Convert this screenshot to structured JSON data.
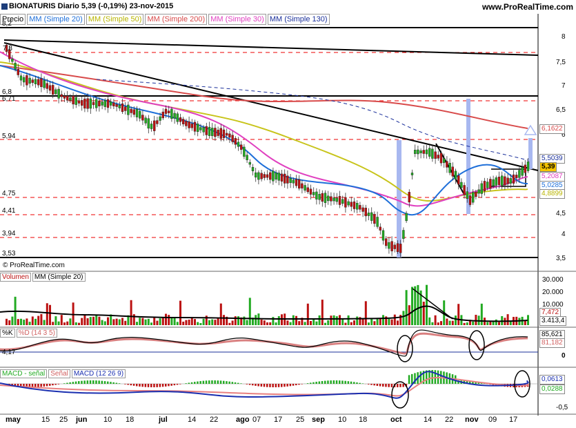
{
  "header": {
    "title": "BIONATURIS   Diario   5,39 (-0,19%)   23-nov-2015",
    "site": "www.ProRealTime.com"
  },
  "legend": [
    "Precio",
    "MM (Simple 20)",
    "MM (Simple 50)",
    "MM (Simple 200)",
    "MM (Simple 30)",
    "MM (Simple 130)"
  ],
  "copyright": "© ProRealTime.com",
  "price_axis": [
    "8",
    "7,5",
    "7",
    "6,5",
    "6",
    "5,5",
    "5",
    "4,5",
    "4",
    "3,5"
  ],
  "price_left_labels": [
    "8,2",
    "7,8",
    "6,8",
    "6,71",
    "5,94",
    "4,75",
    "4,41",
    "3,94",
    "3,53"
  ],
  "price_tags": {
    "mm200": "6,1622",
    "mm130": "5,5039",
    "last": "5,39",
    "mm30": "5,2087",
    "mm20": "5,0285",
    "mm50": "4,8899"
  },
  "volume": {
    "labels": [
      "Volumen",
      "MM (Simple 20)"
    ],
    "axis": [
      "30.000",
      "20.000",
      "10.000"
    ],
    "tag_ma": "7,472",
    "tag_vol": "3.413,4"
  },
  "stoch": {
    "labels": [
      "%K",
      "%D (14 3 5)"
    ],
    "axis": [
      "4,17",
      "0"
    ],
    "tag_k": "85,621",
    "tag_d": "81,182"
  },
  "macd": {
    "labels": [
      "MACD - señal",
      "Señal",
      "MACD (12 26 9)"
    ],
    "axis": [
      "-0,5"
    ],
    "tag_macd": "0,0613",
    "tag_sig": "0,0288"
  },
  "x_axis": {
    "months": [
      {
        "label": "may"
      },
      {
        "label": "jun"
      },
      {
        "label": "jul"
      },
      {
        "label": "ago"
      },
      {
        "label": "sep"
      },
      {
        "label": "oct"
      },
      {
        "label": "nov"
      }
    ],
    "days": [
      "15",
      "25",
      "10",
      "18",
      "14",
      "22",
      "07",
      "17",
      "25",
      "10",
      "18",
      "14",
      "22",
      "09",
      "17"
    ]
  },
  "colors": {
    "mm20": "#1e6fd9",
    "mm50": "#c8c41a",
    "mm200": "#d84a4a",
    "mm30": "#e040c0",
    "mm130": "#1a2f9a",
    "up": "#22aa22",
    "down": "#bb1111"
  }
}
